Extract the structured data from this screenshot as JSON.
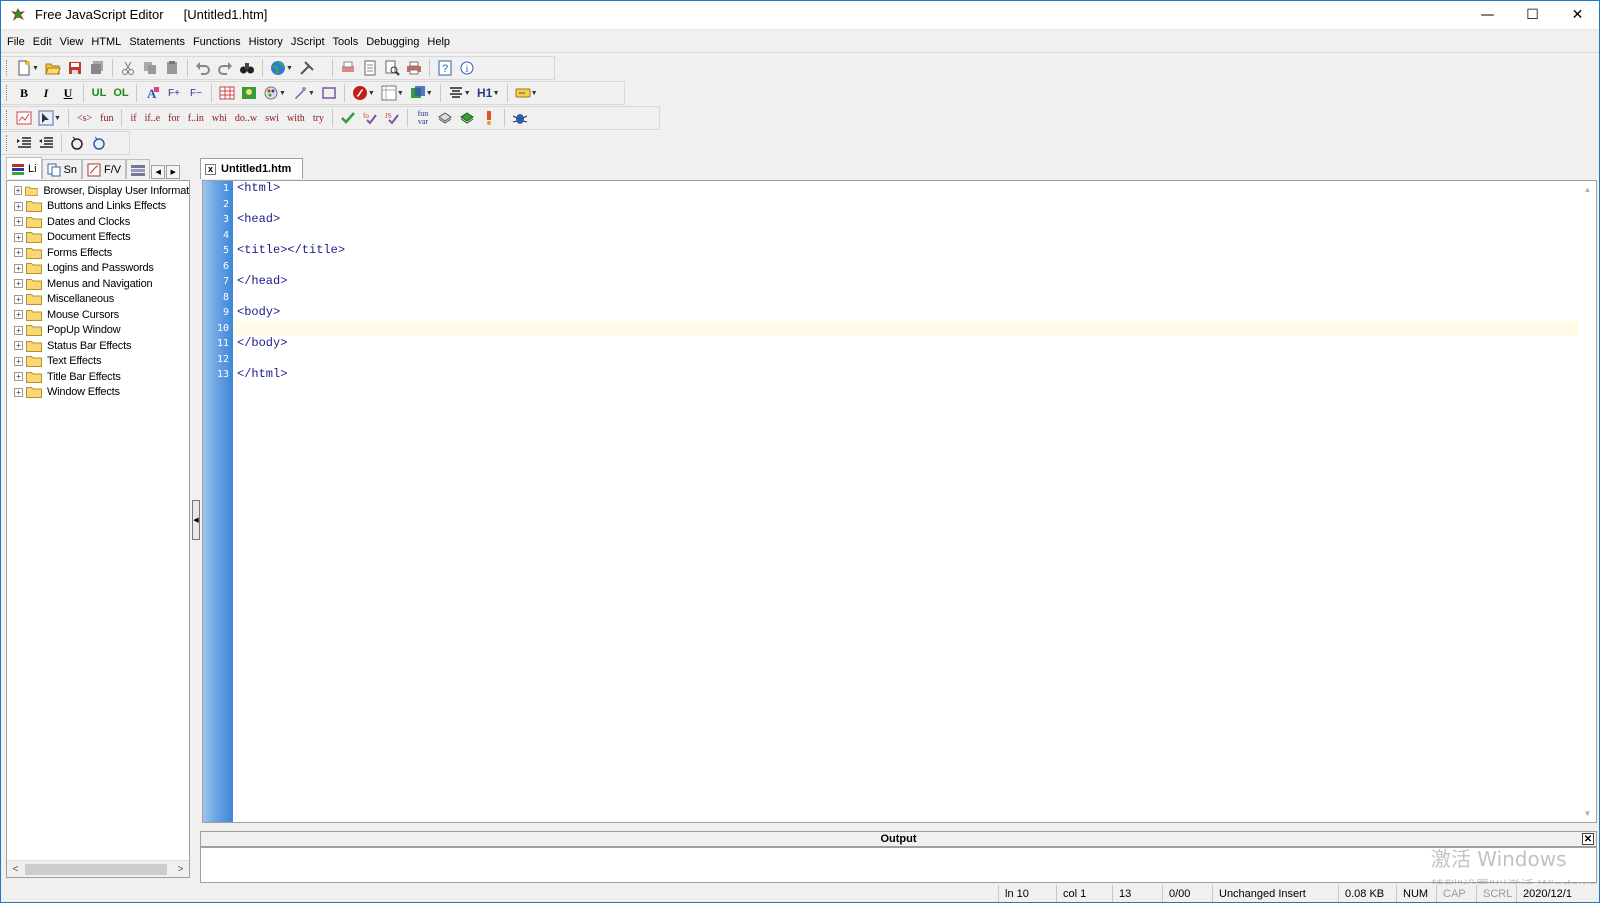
{
  "window": {
    "app_name": "Free JavaScript Editor",
    "document_title": "[Untitled1.htm]",
    "minimize": "—",
    "maximize": "☐",
    "close": "✕"
  },
  "menu": [
    "File",
    "Edit",
    "View",
    "HTML",
    "Statements",
    "Functions",
    "History",
    "JScript",
    "Tools",
    "Debugging",
    "Help"
  ],
  "toolbar_text": {
    "bold": "B",
    "italic": "I",
    "underline": "U",
    "ul": "UL",
    "ol": "OL",
    "font_plus": "F+",
    "font_minus": "F−",
    "h1": "H1",
    "tag": "<s>",
    "fun": "fun",
    "if": "if",
    "ife": "if..e",
    "for": "for",
    "forin": "f..in",
    "whi": "whi",
    "dow": "do..w",
    "swi": "swi",
    "with": "with",
    "try": "try",
    "funvar": "fun var"
  },
  "left_tabs": {
    "library": "Li",
    "snippets": "Sn",
    "fv": "F/V"
  },
  "tree": [
    "Browser, Display User Informat",
    "Buttons and Links Effects",
    "Dates and Clocks",
    "Document Effects",
    "Forms Effects",
    "Logins and Passwords",
    "Menus and Navigation",
    "Miscellaneous",
    "Mouse Cursors",
    "PopUp Window",
    "Status Bar Effects",
    "Text Effects",
    "Title Bar Effects",
    "Window Effects"
  ],
  "doc_tab": "Untitled1.htm",
  "editor": {
    "line_numbers": [
      "1",
      "2",
      "3",
      "4",
      "5",
      "6",
      "7",
      "8",
      "9",
      "10",
      "11",
      "12",
      "13"
    ],
    "lines": [
      "<html>",
      "",
      "<head>",
      "",
      "<title></title>",
      "",
      "</head>",
      "",
      "<body>",
      "",
      "</body>",
      "",
      "</html>"
    ],
    "current_line": 10
  },
  "output": {
    "title": "Output",
    "close": "✕"
  },
  "status": {
    "ln": "ln 10",
    "col": "col 1",
    "total": "13",
    "pos": "0/00",
    "mode": "Unchanged Insert",
    "size": "0.08 KB",
    "num": "NUM",
    "cap": "CAP",
    "scrl": "SCRL",
    "date": "2020/12/1"
  },
  "watermark": {
    "line1": "激活 Windows",
    "line2": "转到\"设置\"以激活 Windows"
  },
  "colors": {
    "code_text": "#1c1c8c",
    "gutter": "#3f86d8",
    "current_line": "#fffbe6",
    "window_border": "#1e77c8"
  }
}
